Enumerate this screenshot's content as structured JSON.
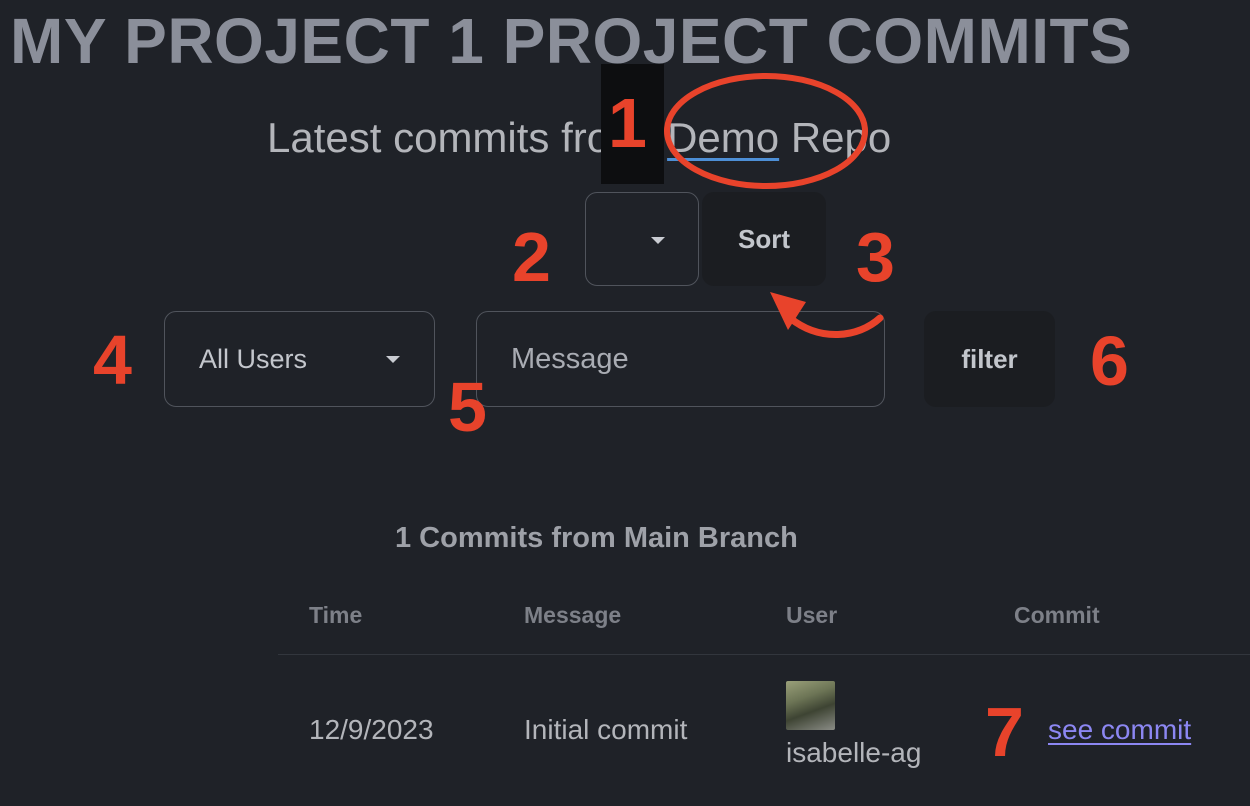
{
  "page": {
    "title": "MY PROJECT 1 PROJECT COMMITS",
    "subtitle_prefix": "Latest commits from",
    "repo_name": "Demo",
    "subtitle_suffix": "Repo"
  },
  "controls": {
    "sort_select_value": "",
    "sort_button_label": "Sort",
    "user_select_value": "All Users",
    "message_placeholder": "Message",
    "filter_button_label": "filter"
  },
  "table": {
    "caption": "1 Commits from Main Branch",
    "columns": [
      "Time",
      "Message",
      "User",
      "Commit"
    ],
    "rows": [
      {
        "time": "12/9/2023",
        "message": "Initial commit",
        "user": "isabelle-ag",
        "commit_link": "see commit"
      }
    ]
  },
  "annotations": {
    "markers": [
      "1",
      "2",
      "3",
      "4",
      "5",
      "6",
      "7"
    ],
    "color": "#e8432b"
  },
  "colors": {
    "background": "#1f2228",
    "link": "#8c87f2",
    "annotation": "#e8432b"
  }
}
